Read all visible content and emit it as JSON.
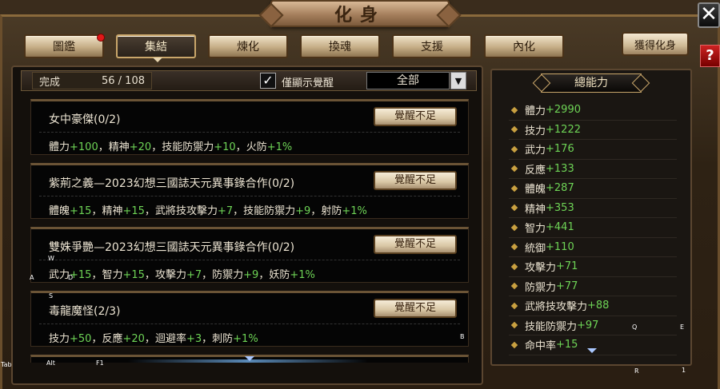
{
  "window": {
    "title": "化身",
    "close_glyph": "✕",
    "help_glyph": "?"
  },
  "tabs": [
    {
      "label": "圖鑑",
      "has_notice": true
    },
    {
      "label": "集結",
      "active": true
    },
    {
      "label": "煉化"
    },
    {
      "label": "換魂"
    },
    {
      "label": "支援"
    },
    {
      "label": "內化"
    }
  ],
  "gain_button": "獲得化身",
  "filter": {
    "progress_label": "完成",
    "progress_value": "56 / 108",
    "checkbox_checked": true,
    "checkbox_glyph": "✓",
    "checkbox_label": "僅顯示覺醒",
    "select_value": "全部",
    "select_arrow": "▼"
  },
  "cards": [
    {
      "title": "女中豪傑(0/2)",
      "button": "覺醒不足",
      "stats": [
        [
          "體力",
          "+100",
          "，"
        ],
        [
          "精神",
          "+20",
          "，"
        ],
        [
          "技能防禦力",
          "+10",
          "，"
        ],
        [
          "火防",
          "+1%",
          ""
        ]
      ]
    },
    {
      "title": "紫荊之義—2023幻想三國誌天元異事錄合作(0/2)",
      "button": "覺醒不足",
      "stats": [
        [
          "體魄",
          "+15",
          "，"
        ],
        [
          "精神",
          "+15",
          "，"
        ],
        [
          "武將技攻擊力",
          "+7",
          "，"
        ],
        [
          "技能防禦力",
          "+9",
          "，"
        ],
        [
          "射防",
          "+1%",
          ""
        ]
      ]
    },
    {
      "title": "雙姝爭艷—2023幻想三國誌天元異事錄合作(0/2)",
      "button": "覺醒不足",
      "stats": [
        [
          "武力",
          "+15",
          "，"
        ],
        [
          "智力",
          "+15",
          "，"
        ],
        [
          "攻擊力",
          "+7",
          "，"
        ],
        [
          "防禦力",
          "+9",
          "，"
        ],
        [
          "妖防",
          "+1%",
          ""
        ]
      ]
    },
    {
      "title": "毒龍魔怪(2/3)",
      "button": "覺醒不足",
      "stats": [
        [
          "技力",
          "+50",
          "，"
        ],
        [
          "反應",
          "+20",
          "，"
        ],
        [
          "迴避率",
          "+3",
          "，"
        ],
        [
          "刺防",
          "+1%",
          ""
        ]
      ]
    }
  ],
  "summary": {
    "header": "總能力",
    "stats": [
      {
        "name": "體力",
        "value": "+2990"
      },
      {
        "name": "技力",
        "value": "+1222"
      },
      {
        "name": "武力",
        "value": "+176"
      },
      {
        "name": "反應",
        "value": "+133"
      },
      {
        "name": "體魄",
        "value": "+287"
      },
      {
        "name": "精神",
        "value": "+353"
      },
      {
        "name": "智力",
        "value": "+441"
      },
      {
        "name": "統御",
        "value": "+110"
      },
      {
        "name": "攻擊力",
        "value": "+71"
      },
      {
        "name": "防禦力",
        "value": "+77"
      },
      {
        "name": "武將技攻擊力",
        "value": "+88"
      },
      {
        "name": "技能防禦力",
        "value": "+97"
      },
      {
        "name": "命中率",
        "value": "+15"
      }
    ]
  },
  "hotkeys": {
    "w": "W",
    "a": "A",
    "d": "D",
    "s": "S",
    "b": "B",
    "q": "Q",
    "e": "E",
    "r": "R",
    "one": "1",
    "tab": "Tab",
    "alt": "Alt",
    "f1": "F1"
  },
  "colors": {
    "bonus_green": "#6ed456",
    "frame_gold": "#c9a66a",
    "notice_red": "#e01818"
  }
}
